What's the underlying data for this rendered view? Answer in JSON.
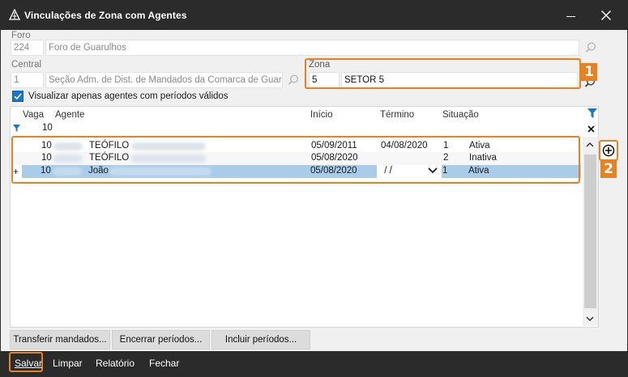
{
  "window": {
    "title": "Vinculações de Zona com Agentes"
  },
  "foro": {
    "label": "Foro",
    "code": "224",
    "name": "Foro de Guarulhos"
  },
  "central": {
    "label": "Central",
    "code": "1",
    "name": "Seção Adm. de Dist. de Mandados da Comarca de Guarul"
  },
  "zona": {
    "label": "Zona",
    "code": "5",
    "name": "SETOR 5"
  },
  "badges": {
    "one": "1",
    "two": "2"
  },
  "filter": {
    "checkbox_label": "Visualizar apenas agentes com períodos válidos",
    "checked": true
  },
  "grid": {
    "headers": {
      "vaga": "Vaga",
      "agente": "Agente",
      "inicio": "Início",
      "termino": "Término",
      "situacao": "Situação"
    },
    "filter_vaga": "10",
    "new_row_marker": "+",
    "rows": [
      {
        "vaga": "10",
        "agente": "TEÓFILO",
        "inicio": "05/09/2011",
        "termino": "04/08/2020",
        "sit_code": "1",
        "situacao": "Ativa"
      },
      {
        "vaga": "10",
        "agente": "TEÓFILO",
        "inicio": "05/08/2020",
        "termino": "",
        "sit_code": "2",
        "situacao": "Inativa"
      },
      {
        "vaga": "10",
        "agente": "João",
        "inicio": "05/08/2020",
        "termino": " / /",
        "sit_code": "1",
        "situacao": "Ativa"
      }
    ]
  },
  "actions": {
    "transferir": "Transferir mandados...",
    "encerrar": "Encerrar períodos...",
    "incluir": "Incluir períodos..."
  },
  "bottom": {
    "salvar": "Salvar",
    "limpar": "Limpar",
    "relatorio": "Relatório",
    "fechar": "Fechar"
  },
  "colors": {
    "accent_orange": "#e8821f",
    "selected_row": "#a9cce9",
    "checkbox_blue": "#1c76c7",
    "dark_bar": "#2b2b2b"
  }
}
